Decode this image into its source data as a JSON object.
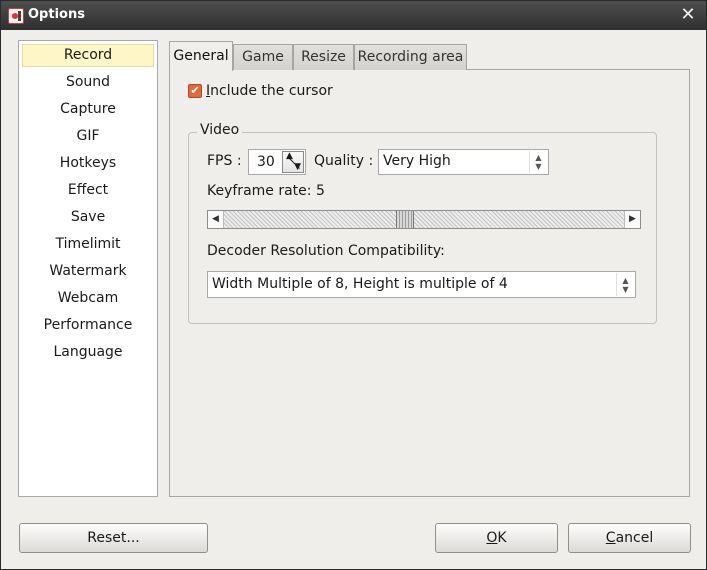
{
  "window": {
    "title": "Options",
    "close_glyph": "✕"
  },
  "sidebar": {
    "selected": "Record",
    "items": [
      {
        "label": "Record"
      },
      {
        "label": "Sound"
      },
      {
        "label": "Capture"
      },
      {
        "label": "GIF"
      },
      {
        "label": "Hotkeys"
      },
      {
        "label": "Effect"
      },
      {
        "label": "Save"
      },
      {
        "label": "Timelimit"
      },
      {
        "label": "Watermark"
      },
      {
        "label": "Webcam"
      },
      {
        "label": "Performance"
      },
      {
        "label": "Language"
      }
    ]
  },
  "tabs": [
    {
      "label": "General",
      "active": true
    },
    {
      "label": "Game"
    },
    {
      "label": "Resize"
    },
    {
      "label": "Recording area"
    }
  ],
  "general": {
    "include_cursor": {
      "label_first": "I",
      "label_rest": "nclude the cursor",
      "checked": true
    },
    "video": {
      "title": "Video",
      "fps_label": "FPS :",
      "fps_value": "30",
      "quality_label": "Quality :",
      "quality_value": "Very High",
      "keyframe_label": "Keyframe rate: 5",
      "keyframe_slider_fraction": 0.45,
      "decoder_label": "Decoder Resolution Compatibility:",
      "decoder_value": "Width Multiple of 8, Height is multiple of 4"
    }
  },
  "buttons": {
    "reset": "Reset...",
    "ok_first": "O",
    "ok_rest": "K",
    "cancel_first": "C",
    "cancel_rest": "ancel"
  },
  "colors": {
    "checkbox_accent": "#e06a3e",
    "selected_nav_bg": "#fff6c8"
  }
}
